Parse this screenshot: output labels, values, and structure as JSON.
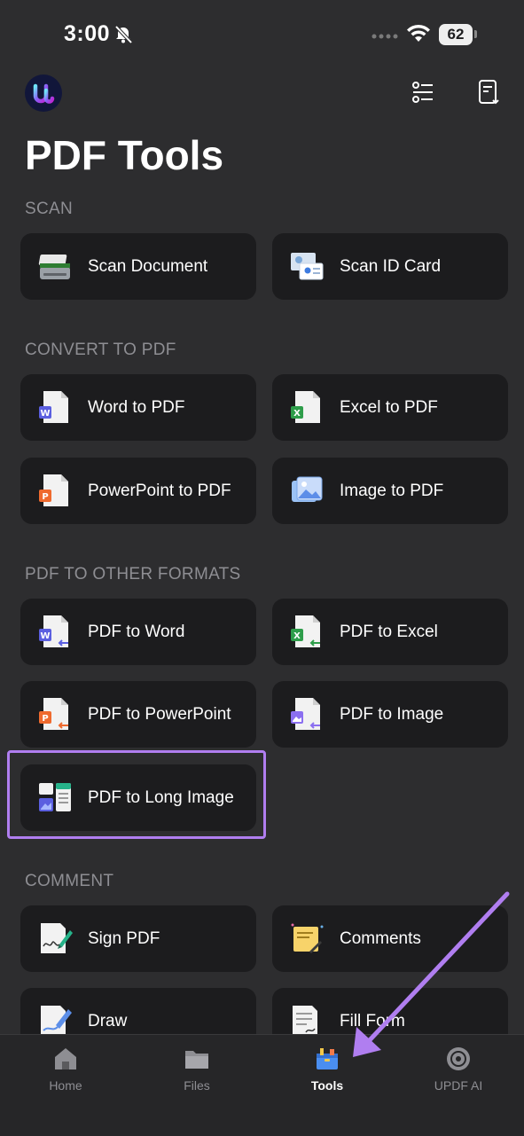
{
  "status": {
    "time": "3:00",
    "battery": "62"
  },
  "header": {
    "title": "PDF Tools"
  },
  "sections": {
    "scan": "SCAN",
    "convert": "CONVERT TO PDF",
    "other": "PDF TO OTHER FORMATS",
    "comment": "COMMENT"
  },
  "tools": {
    "scan_document": "Scan Document",
    "scan_id_card": "Scan ID Card",
    "word_to_pdf": "Word to PDF",
    "excel_to_pdf": "Excel to PDF",
    "powerpoint_to_pdf": "PowerPoint to PDF",
    "image_to_pdf": "Image to PDF",
    "pdf_to_word": "PDF to Word",
    "pdf_to_excel": "PDF to Excel",
    "pdf_to_powerpoint": "PDF to PowerPoint",
    "pdf_to_image": "PDF to Image",
    "pdf_to_long_image": "PDF to Long Image",
    "sign_pdf": "Sign PDF",
    "comments": "Comments",
    "draw": "Draw",
    "fill_form": "Fill Form"
  },
  "tabs": {
    "home": "Home",
    "files": "Files",
    "tools": "Tools",
    "ai": "UPDF AI"
  },
  "colors": {
    "accent": "#b07ef0",
    "card": "#1c1c1e",
    "background": "#2d2d2f"
  }
}
